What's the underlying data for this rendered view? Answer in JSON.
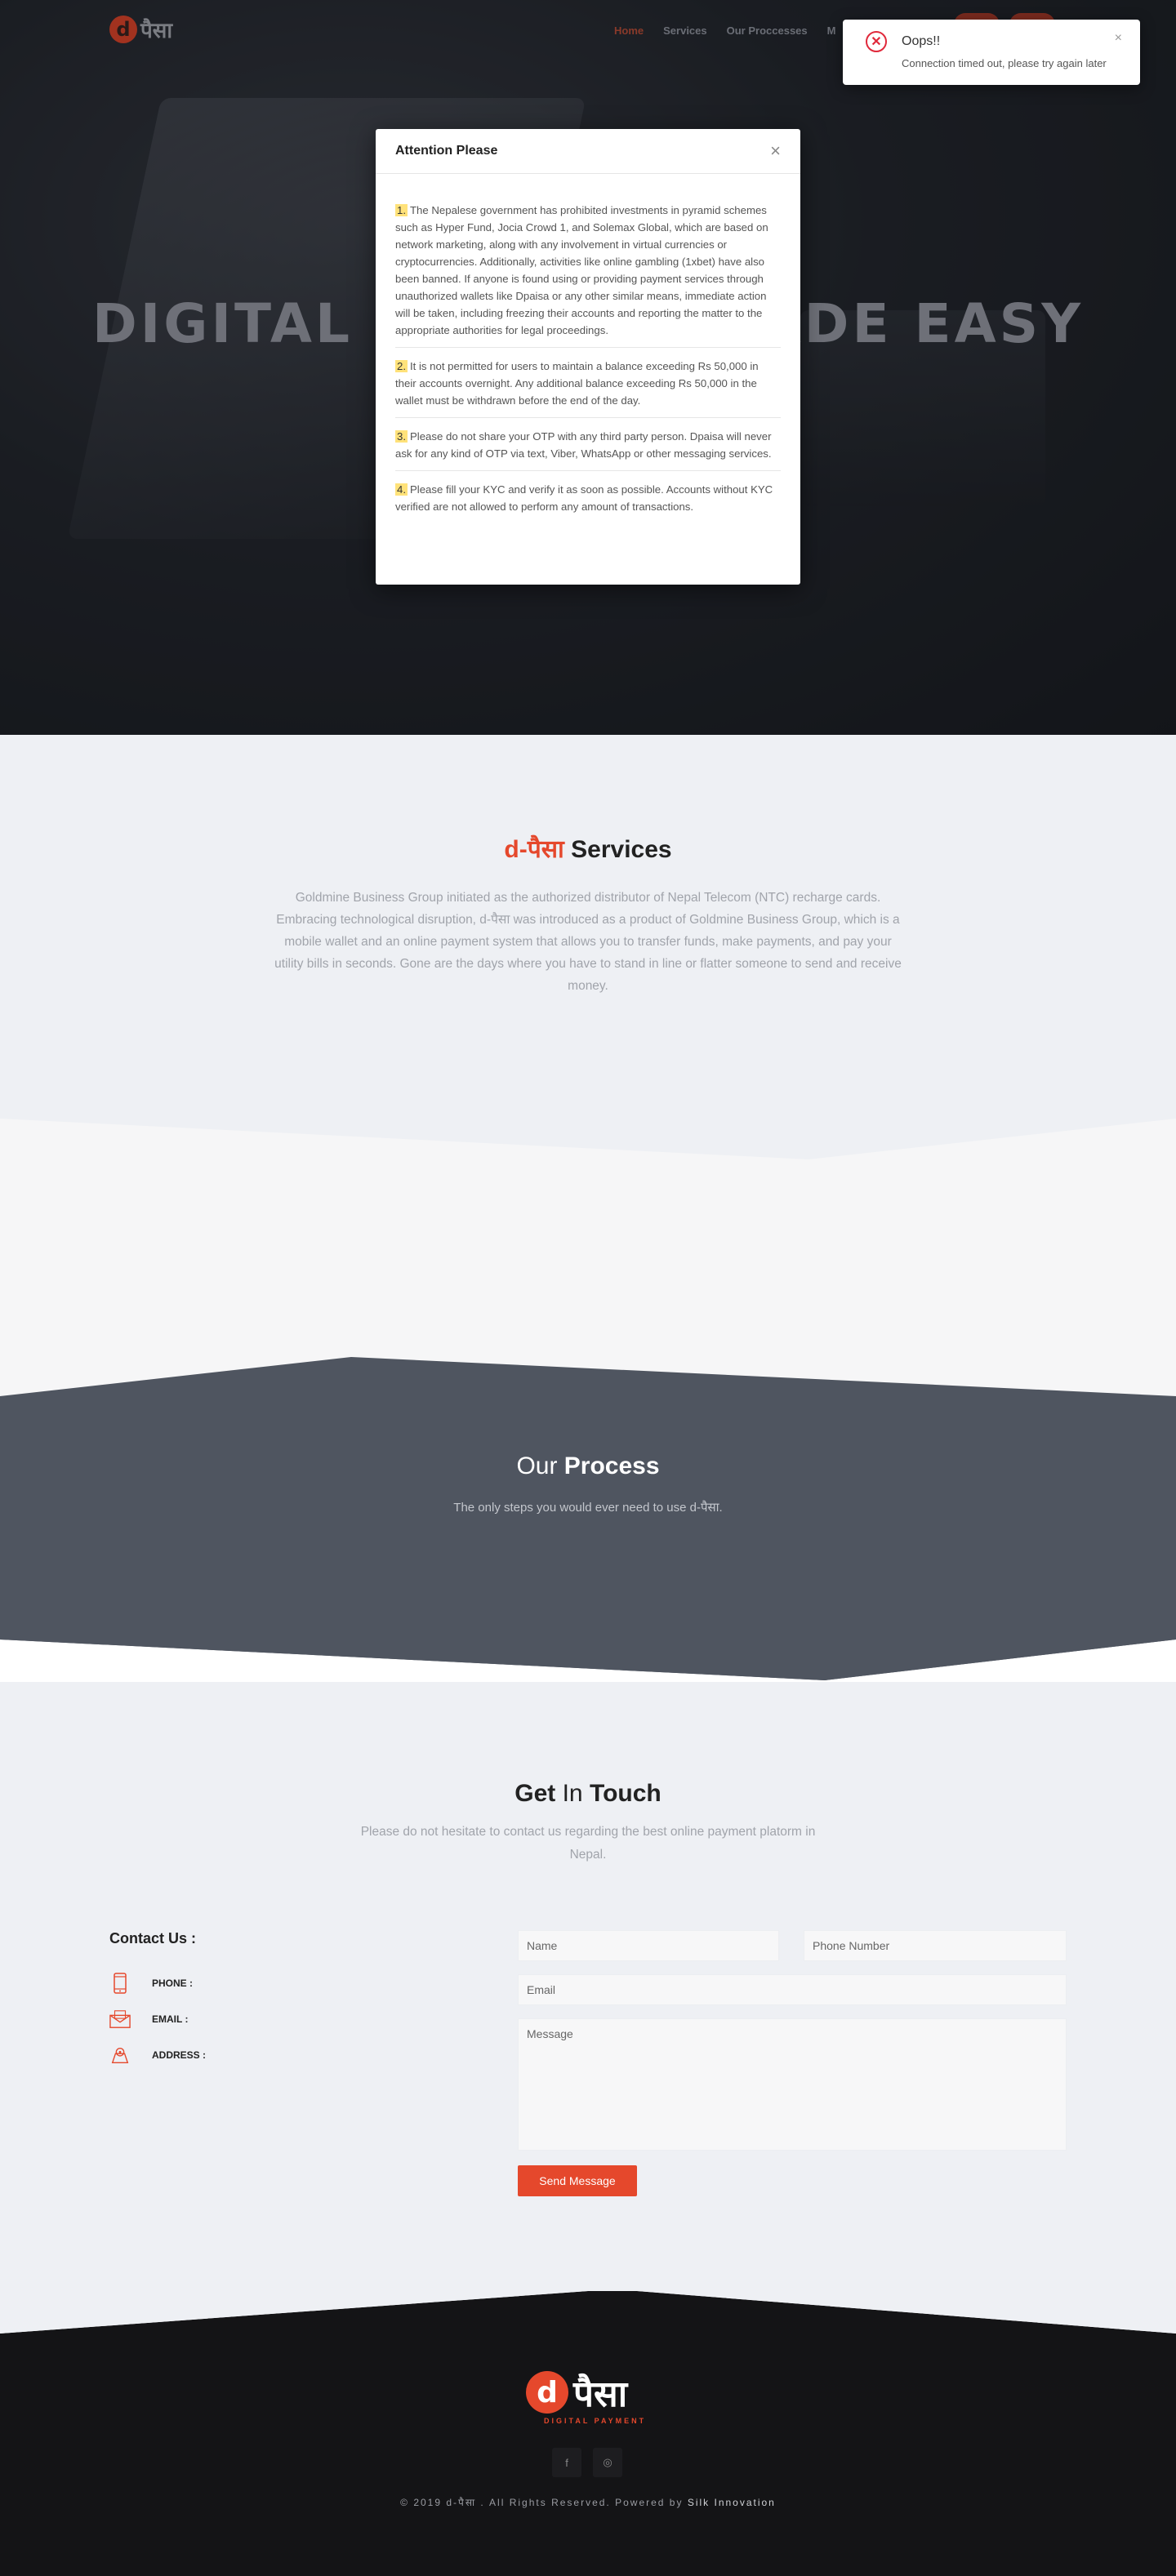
{
  "nav": {
    "logo_letter": "d",
    "logo_text": "पैसा",
    "links": [
      "Home",
      "Services",
      "Our Proccesses",
      "M"
    ]
  },
  "hero": {
    "title": "DIGITAL PAYMENT MADE EASY"
  },
  "modal": {
    "title": "Attention Please",
    "close": "×",
    "notices": [
      {
        "num": "1.",
        "text": "The Nepalese government has prohibited investments in pyramid schemes such as Hyper Fund, Jocia Crowd 1, and Solemax Global, which are based on network marketing, along with any involvement in virtual currencies or cryptocurrencies. Additionally, activities like online gambling (1xbet) have also been banned. If anyone is found using or providing payment services through unauthorized wallets like Dpaisa or any other similar means, immediate action will be taken, including freezing their accounts and reporting the matter to the appropriate authorities for legal proceedings."
      },
      {
        "num": "2.",
        "text": "It is not permitted for users to maintain a balance exceeding Rs 50,000 in their accounts overnight. Any additional balance exceeding Rs 50,000 in the wallet must be withdrawn before the end of the day."
      },
      {
        "num": "3.",
        "text": "Please do not share your OTP with any third party person. Dpaisa will never ask for any kind of OTP via text, Viber, WhatsApp or other messaging services."
      },
      {
        "num": "4.",
        "text": "Please fill your KYC and verify it as soon as possible. Accounts without KYC verified are not allowed to perform any amount of transactions."
      }
    ]
  },
  "toast": {
    "icon": "error-circle-icon",
    "title": "Oops!!",
    "message": "Connection timed out, please try again later",
    "close": "×"
  },
  "services": {
    "title_accent": "d-पैसा",
    "title_rest": " Services",
    "text": "Goldmine Business Group initiated as the authorized distributor of Nepal Telecom (NTC) recharge cards. Embracing technological disruption, d-पैसा was introduced as a product of Goldmine Business Group, which is a mobile wallet and an online payment system that allows you to transfer funds, make payments, and pay your utility bills in seconds. Gone are the days where you have to stand in line or flatter someone to send and receive money."
  },
  "process": {
    "title_thin": "Our ",
    "title_bold": "Process",
    "subtitle": "The only steps you would ever need to use d-पैसा."
  },
  "contact": {
    "title_a": "Get",
    "title_b": " In ",
    "title_c": "Touch",
    "subtitle": "Please do not hesitate to contact us regarding the best online payment platorm in Nepal.",
    "heading": "Contact Us :",
    "phone_label": "PHONE :",
    "email_label": "EMAIL :",
    "address_label": "ADDRESS :",
    "name_placeholder": "Name",
    "phone_placeholder": "Phone Number",
    "email_placeholder": "Email",
    "message_placeholder": "Message",
    "send_label": "Send Message"
  },
  "footer": {
    "logo_letter": "d",
    "logo_text": "पैसा",
    "tagline": "DIGITAL PAYMENT",
    "social": [
      {
        "icon": "facebook-icon",
        "glyph": "f"
      },
      {
        "icon": "instagram-icon",
        "glyph": "◎"
      }
    ],
    "copyright_prefix": "© 2019 d-पैसा . All Rights Reserved. Powered by ",
    "powered_by": "Silk Innovation"
  },
  "colors": {
    "accent": "#e5482c",
    "process_band": "#4f5560",
    "footer": "#141416",
    "toast_error": "#e0293b",
    "highlight": "#ffe27a"
  }
}
